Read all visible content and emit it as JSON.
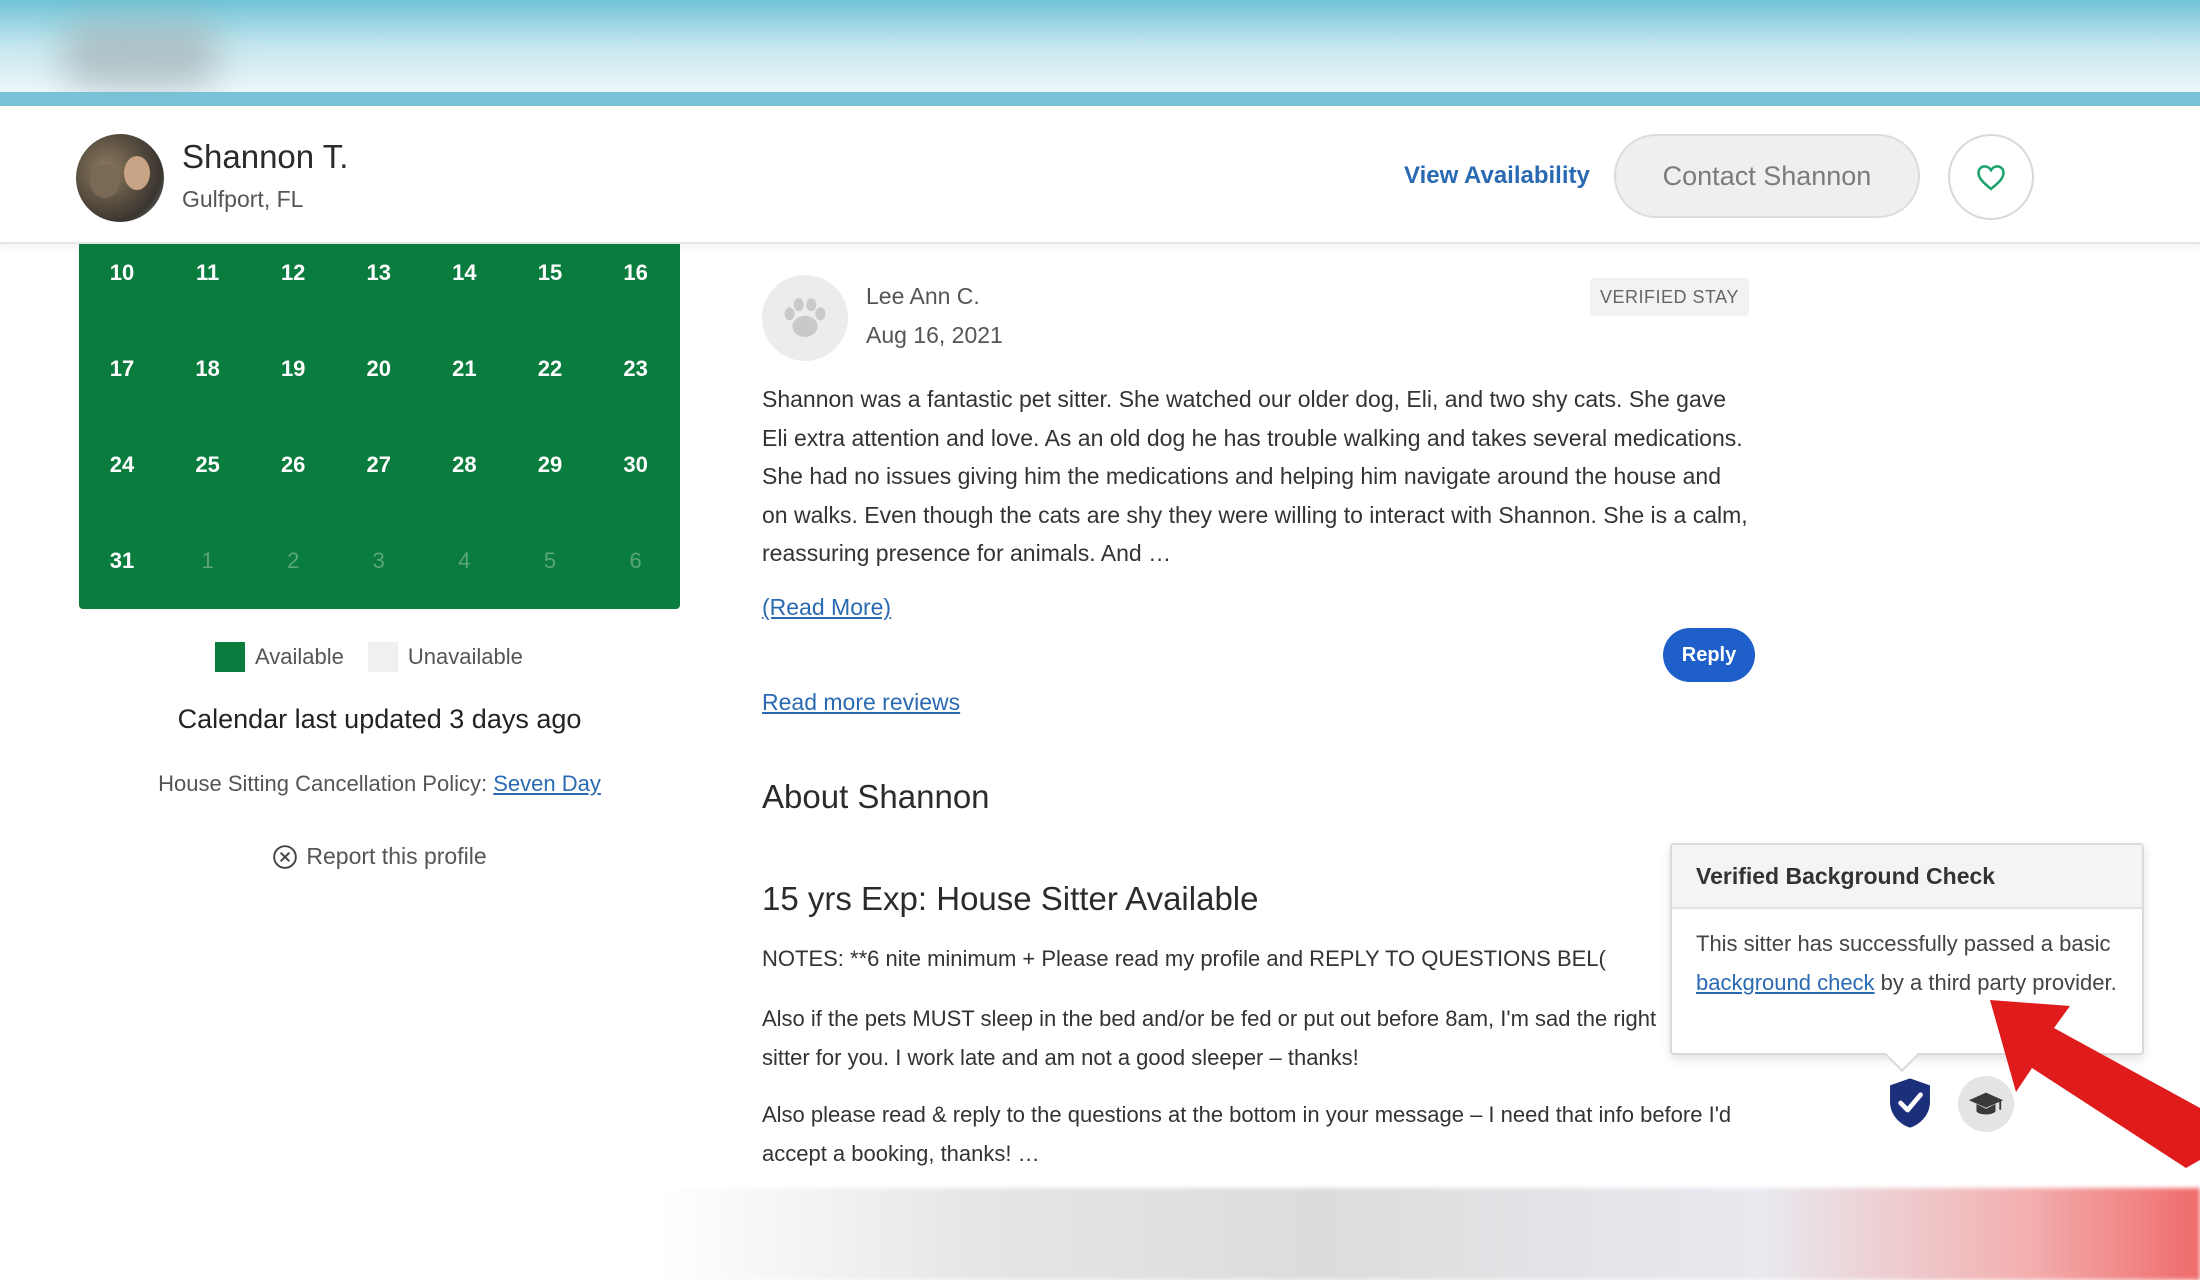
{
  "header": {
    "host_name": "Shannon T.",
    "host_location": "Gulfport, FL",
    "view_availability": "View Availability",
    "contact_label": "Contact Shannon"
  },
  "calendar": {
    "rows": [
      [
        {
          "d": "10",
          "muted": false
        },
        {
          "d": "11",
          "muted": false
        },
        {
          "d": "12",
          "muted": false
        },
        {
          "d": "13",
          "muted": false
        },
        {
          "d": "14",
          "muted": false
        },
        {
          "d": "15",
          "muted": false
        },
        {
          "d": "16",
          "muted": false
        }
      ],
      [
        {
          "d": "17",
          "muted": false
        },
        {
          "d": "18",
          "muted": false
        },
        {
          "d": "19",
          "muted": false
        },
        {
          "d": "20",
          "muted": false
        },
        {
          "d": "21",
          "muted": false
        },
        {
          "d": "22",
          "muted": false
        },
        {
          "d": "23",
          "muted": false
        }
      ],
      [
        {
          "d": "24",
          "muted": false
        },
        {
          "d": "25",
          "muted": false
        },
        {
          "d": "26",
          "muted": false
        },
        {
          "d": "27",
          "muted": false
        },
        {
          "d": "28",
          "muted": false
        },
        {
          "d": "29",
          "muted": false
        },
        {
          "d": "30",
          "muted": false
        }
      ],
      [
        {
          "d": "31",
          "muted": false
        },
        {
          "d": "1",
          "muted": true
        },
        {
          "d": "2",
          "muted": true
        },
        {
          "d": "3",
          "muted": true
        },
        {
          "d": "4",
          "muted": true
        },
        {
          "d": "5",
          "muted": true
        },
        {
          "d": "6",
          "muted": true
        }
      ]
    ],
    "legend_available": "Available",
    "legend_unavailable": "Unavailable",
    "updated": "Calendar last updated 3 days ago",
    "policy_prefix": "House Sitting Cancellation Policy: ",
    "policy_link": "Seven Day",
    "report": "Report this profile",
    "colors": {
      "available": "#0a7d3e",
      "unavailable": "#f0f0f0"
    }
  },
  "review": {
    "reviewer": "Lee Ann C.",
    "date": "Aug 16, 2021",
    "badge": "VERIFIED STAY",
    "text": "Shannon was a fantastic pet sitter. She watched our older dog, Eli, and two shy cats. She gave Eli extra attention and love. As an old dog he has trouble walking and takes several medications. She had no issues giving him the medications and helping him navigate around the house and on walks. Even though the cats are shy they were willing to interact with Shannon. She is a calm, reassuring presence for animals. And …",
    "read_more": "(Read More)",
    "reply": "Reply",
    "read_more_reviews": "Read more reviews"
  },
  "about": {
    "title": "About Shannon",
    "subtitle": "15 yrs Exp: House Sitter Available",
    "notes": "NOTES: **6 nite minimum + Please read my profile and REPLY TO QUESTIONS BEL(",
    "p2": "Also if the pets MUST sleep in the bed and/or be fed or put out before 8am, I'm sad the right sitter for you. I work late and am not a good sleeper – thanks!",
    "p3": "Also please read & reply to the questions at the bottom in your message – I need that info before I'd accept a booking, thanks! …"
  },
  "tooltip": {
    "title": "Verified Background Check",
    "text_before": "This sitter has successfully passed a basic ",
    "link": "background check",
    "text_after": " by a third party provider."
  },
  "icons": {
    "heart": "heart-icon",
    "paw": "paw-icon",
    "report": "circle-x-icon",
    "shield": "shield-check-icon",
    "grad": "graduation-cap-icon",
    "arrow": "red-arrow-annotation"
  },
  "colors": {
    "accent_link": "#2a6ab3",
    "reply_button": "#1f5fc9",
    "calendar_green": "#0a7d3e",
    "shield_navy": "#1c2f7a",
    "arrow_red": "#e01b1b"
  }
}
